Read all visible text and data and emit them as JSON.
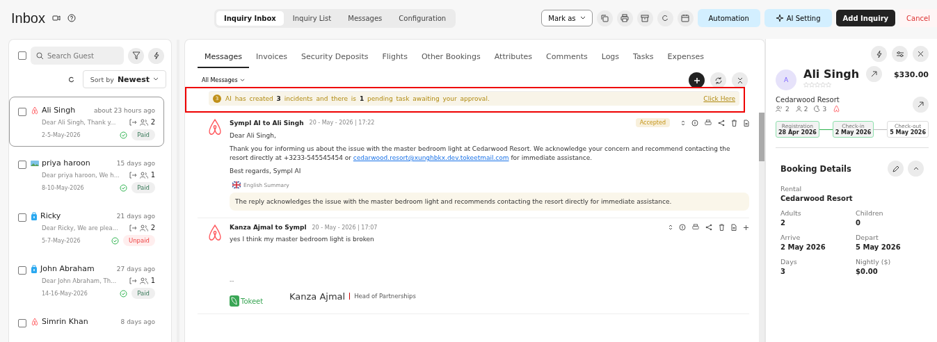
{
  "header": {
    "title": "Inbox",
    "view_tabs": [
      {
        "label": "Inquiry Inbox",
        "selected": true
      },
      {
        "label": "Inquiry List",
        "selected": false
      },
      {
        "label": "Messages",
        "selected": false
      },
      {
        "label": "Configuration",
        "selected": false
      }
    ],
    "mark_as": "Mark as",
    "automation": "Automation",
    "ai_setting": "AI Setting",
    "add_inquiry": "Add Inquiry",
    "cancel": "Cancel"
  },
  "sidebar": {
    "search": {
      "placeholder": "Search Guest"
    },
    "sort_label": "Sort by",
    "sort_value": "Newest",
    "select_all": false,
    "items": [
      {
        "name": "Ali Singh",
        "kind": "airbnb",
        "time": "about 23 hours ago",
        "preview": "Dear Ali Singh, Thank y...",
        "guests": "2",
        "dates": "2-5-May-2026",
        "paid": true,
        "status": "Paid",
        "selected": true,
        "checked": false
      },
      {
        "name": "priya haroon",
        "kind": "other",
        "time": "15 days ago",
        "preview": "Dear priya haroon, We h...",
        "guests": "1",
        "dates": "8-10-May-2026",
        "paid": true,
        "status": "Paid",
        "selected": false,
        "checked": false
      },
      {
        "name": "Ricky",
        "kind": "lock",
        "time": "21 days ago",
        "preview": "Dear Ricky, We are plea...",
        "guests": "2",
        "dates": "5-7-May-2026",
        "paid": false,
        "status": "Unpaid",
        "selected": false,
        "checked": false
      },
      {
        "name": "John Abraham",
        "kind": "lock",
        "time": "27 days ago",
        "preview": "Dear John Abraham, Th...",
        "guests": "1",
        "dates": "14-16-May-2026",
        "paid": true,
        "status": "Paid",
        "selected": false,
        "checked": false
      },
      {
        "name": "Simrin Khan",
        "kind": "airbnb",
        "time": "8 days ago",
        "selected": false,
        "checked": false
      }
    ]
  },
  "center": {
    "tabs": [
      {
        "label": "Messages",
        "selected": true
      },
      {
        "label": "Invoices",
        "selected": false
      },
      {
        "label": "Security Deposits",
        "selected": false
      },
      {
        "label": "Flights",
        "selected": false
      },
      {
        "label": "Other Bookings",
        "selected": false
      },
      {
        "label": "Attributes",
        "selected": false
      },
      {
        "label": "Comments",
        "selected": false
      },
      {
        "label": "Logs",
        "selected": false
      },
      {
        "label": "Tasks",
        "selected": false
      },
      {
        "label": "Expenses",
        "selected": false
      }
    ],
    "filter": "All Messages",
    "alert": {
      "badge": "3",
      "text": "AI has created **3** incidents and there is **1** pending task awaiting your approval.",
      "link": "Click Here"
    },
    "messages": [
      {
        "sender": "Sympl AI to Ali Singh",
        "date": "20 - May - 2026 | 17:22",
        "status": "Accepted",
        "lines": [
          "Dear Ali Singh,"
        ],
        "body_before": "Thank you for informing us about the issue with the master bedroom light at Cedarwood Resort. We acknowledge your concern and recommend contacting the resort directly at +3233-545545454 or ",
        "email": "cedarwood.resort@xunghbkx.dev.tokeetmail.com",
        "body_after": " for immediate assistance.",
        "closing": "Best regards, Sympl AI",
        "summary_label": "English Summary",
        "summary": "The reply acknowledges the issue with the master bedroom light and recommends contacting the resort directly for immediate assistance.",
        "can_add": false
      },
      {
        "sender": "Kanza Ajmal to Sympl",
        "date": "20 - May - 2026 | 17:07",
        "lines": [
          "yes I think my master bedroom light is broken"
        ],
        "can_add": true,
        "signature": {
          "dash": "--",
          "logo": "Tokeet",
          "name": "Kanza Ajmal",
          "role": "Head of Partnerships"
        }
      }
    ]
  },
  "guest": {
    "initial": "A",
    "name": "Ali Singh",
    "stars": 0,
    "amount": "$330.00",
    "rental": "Cedarwood Resort",
    "adults": "2",
    "guests": "2",
    "nights": "3",
    "timeline": [
      {
        "label": "Registration",
        "date": "28 Apr 2026",
        "done": true
      },
      {
        "label": "Check-in",
        "date": "2 May 2026",
        "done": true
      },
      {
        "label": "Check-out",
        "date": "5 May 2026",
        "done": false
      }
    ],
    "booking_title": "Booking Details",
    "details": [
      {
        "label": "Rental",
        "value": "Cedarwood Resort"
      },
      {
        "label": "Adults",
        "value": "2"
      },
      {
        "label": "Children",
        "value": "0"
      },
      {
        "label": "Arrive",
        "value": "2 May 2026"
      },
      {
        "label": "Depart",
        "value": "5 May 2026"
      },
      {
        "label": "Days",
        "value": "3"
      },
      {
        "label": "Nightly ($)",
        "value": "$0.00"
      }
    ]
  }
}
